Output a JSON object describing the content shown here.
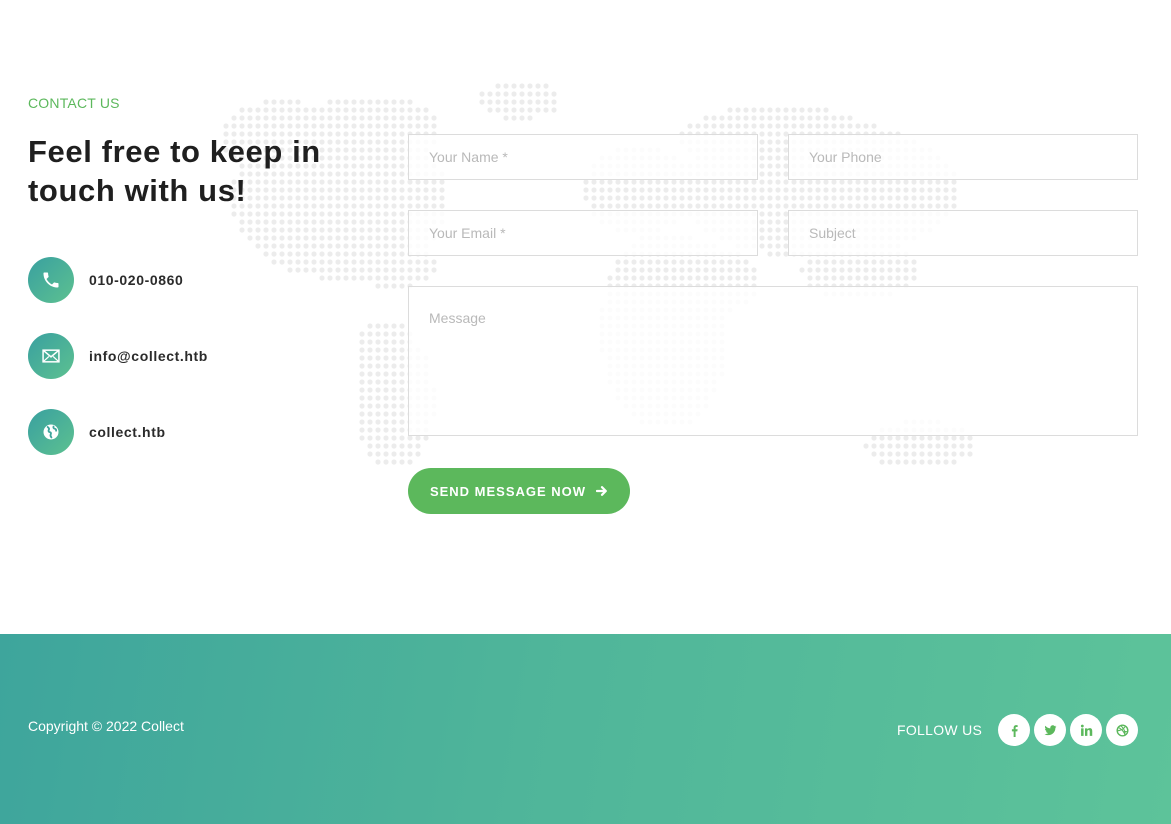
{
  "contact": {
    "eyebrow": "CONTACT US",
    "heading": "Feel free to keep in touch with us!",
    "info": [
      {
        "icon": "phone-icon",
        "text": "010-020-0860"
      },
      {
        "icon": "envelope-icon",
        "text": "info@collect.htb"
      },
      {
        "icon": "globe-icon",
        "text": "collect.htb"
      }
    ]
  },
  "form": {
    "name_placeholder": "Your Name *",
    "phone_placeholder": "Your Phone",
    "email_placeholder": "Your Email *",
    "subject_placeholder": "Subject",
    "message_placeholder": "Message",
    "send_label": "SEND MESSAGE NOW"
  },
  "footer": {
    "copyright": "Copyright © 2022 Collect",
    "follow_label": "FOLLOW US",
    "socials": [
      "facebook-icon",
      "twitter-icon",
      "linkedin-icon",
      "dribbble-icon"
    ]
  },
  "colors": {
    "accent": "#5cb85c",
    "footer_start": "#3ea59c",
    "footer_end": "#5dc39a",
    "heading": "#1f1f1f"
  }
}
